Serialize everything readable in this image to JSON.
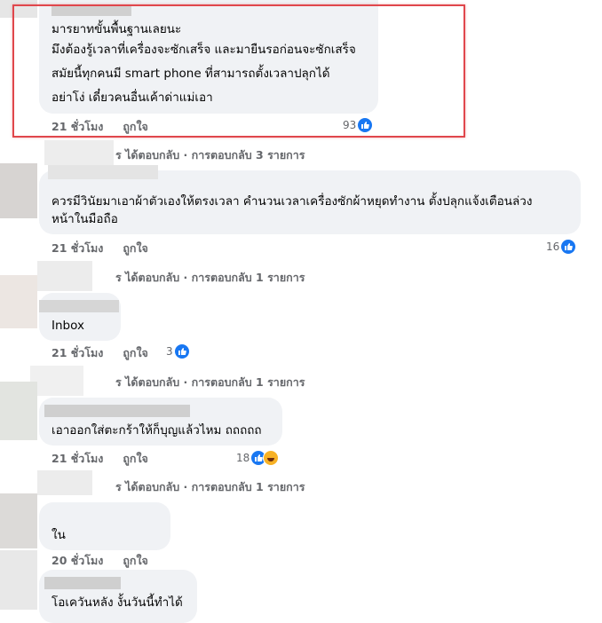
{
  "comments": [
    {
      "lines": [
        "มารยาทขั้นพื้นฐานเลยนะ",
        "มึงต้องรู้เวลาที่เครื่องจะซักเสร็จ และมายืนรอก่อนจะซักเสร็จ",
        "สมัยนี้ทุกคนมี smart phone ที่สามารถตั้งเวลาปลุกได้",
        "อย่าโง่ เดี๋ยวคนอื่นเค้าด่าแม่เอา"
      ],
      "time": "21 ชั่วโมง",
      "like_action": "ถูกใจ",
      "reaction_count": "93",
      "replies": "ได้ตอบกลับ · การตอบกลับ 3 รายการ",
      "reply_prefix": "ร"
    },
    {
      "lines": [
        "ควรมีวินัยมาเอาผ้าตัวเองให้ตรงเวลา คำนวนเวลาเครื่องซักผ้าหยุดทำงาน ตั้งปลุกแจ้งเตือนล่วง",
        "หน้าในมือถือ"
      ],
      "time": "21 ชั่วโมง",
      "like_action": "ถูกใจ",
      "reaction_count": "16",
      "replies": "ได้ตอบกลับ · การตอบกลับ 1 รายการ",
      "reply_prefix": "ร"
    },
    {
      "lines": [
        "Inbox"
      ],
      "time": "21 ชั่วโมง",
      "like_action": "ถูกใจ",
      "reaction_count": "3",
      "replies": "ได้ตอบกลับ · การตอบกลับ 1 รายการ",
      "reply_prefix": "ร"
    },
    {
      "lines": [
        "เอาออกใส่ตะกร้าให้ก็บุญแล้วไหม ถถถถถ"
      ],
      "time": "21 ชั่วโมง",
      "like_action": "ถูกใจ",
      "reaction_count": "18",
      "replies": "ได้ตอบกลับ · การตอบกลับ 1 รายการ",
      "reply_prefix": "ร"
    },
    {
      "lines": [
        "ใน"
      ],
      "time": "20 ชั่วโมง",
      "like_action": "ถูกใจ"
    },
    {
      "lines": [
        "โอเควันหลัง งั้นวันนี้ทำได้"
      ]
    }
  ],
  "colors": {
    "bubble": "#f0f2f5",
    "meta": "#65676b",
    "like_blue": "#1877f2",
    "highlight": "#e0474c"
  }
}
